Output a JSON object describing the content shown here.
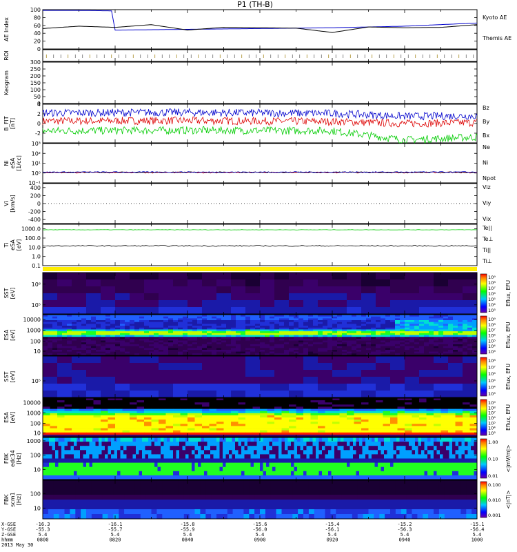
{
  "title": "P1  (TH-B)",
  "footer": {
    "labels": [
      "X-GSE",
      "Y-GSE",
      "Z-GSE",
      "hhmm",
      "2013 May 30"
    ],
    "ticks": [
      {
        "x": "-16.3",
        "y": "-55.3",
        "z": "5.4",
        "t": "0800"
      },
      {
        "x": "-16.1",
        "y": "-55.7",
        "z": "5.4",
        "t": "0820"
      },
      {
        "x": "-15.8",
        "y": "-55.9",
        "z": "5.4",
        "t": "0840"
      },
      {
        "x": "-15.6",
        "y": "-56.0",
        "z": "5.4",
        "t": "0900"
      },
      {
        "x": "-15.4",
        "y": "-56.1",
        "z": "5.4",
        "t": "0920"
      },
      {
        "x": "-15.2",
        "y": "-56.3",
        "z": "5.4",
        "t": "0940"
      },
      {
        "x": "-15.1",
        "y": "-56.4",
        "z": "5.4",
        "t": "1000"
      }
    ]
  },
  "chart_data": {
    "type": "line",
    "time_range": [
      "0800",
      "1000"
    ],
    "panels": [
      {
        "id": "ae",
        "ylabel": "AE Index",
        "yticks": [
          "100",
          "80",
          "60",
          "40",
          "20",
          "0"
        ],
        "ylim": [
          0,
          100
        ],
        "series": [
          {
            "name": "Kyoto AE",
            "color": "#0000cc",
            "x": [
              "0800",
              "0810",
              "0819",
              "0820",
              "0840",
              "0900",
              "0920",
              "0940",
              "1000"
            ],
            "y": [
              98,
              98,
              97,
              48,
              50,
              52,
              54,
              58,
              66
            ]
          },
          {
            "name": "Themis AE",
            "color": "#000000",
            "x": [
              "0800",
              "0810",
              "0820",
              "0830",
              "0840",
              "0850",
              "0900",
              "0910",
              "0920",
              "0930",
              "0940",
              "0950",
              "1000"
            ],
            "y": [
              52,
              58,
              55,
              62,
              48,
              55,
              54,
              53,
              42,
              56,
              54,
              55,
              62
            ]
          }
        ]
      },
      {
        "id": "roi",
        "ylabel": "ROI"
      },
      {
        "id": "keogram",
        "ylabel": "Keogram",
        "yticks": [
          "300",
          "250",
          "200",
          "150",
          "100",
          "50",
          "0"
        ],
        "ylim": [
          0,
          300
        ]
      },
      {
        "id": "bfit",
        "ylabel": [
          "B_FIT",
          "[nT]"
        ],
        "yticks": [
          "4",
          "2",
          "0",
          "-2"
        ],
        "ylim": [
          -4,
          4
        ],
        "series": [
          {
            "name": "Bz",
            "color": "#dd0000",
            "x": [
              "0800",
              "0840",
              "0920",
              "0940",
              "1000"
            ],
            "y": [
              0.5,
              0.6,
              0.4,
              0.0,
              0.2
            ]
          },
          {
            "name": "By",
            "color": "#00cc00",
            "x": [
              "0800",
              "0840",
              "0920",
              "0940",
              "1000"
            ],
            "y": [
              -1.5,
              -1.4,
              -1.5,
              -3.4,
              -2.8
            ]
          },
          {
            "name": "Bx",
            "color": "#0000cc",
            "x": [
              "0800",
              "0840",
              "0920",
              "0940",
              "1000"
            ],
            "y": [
              2.2,
              2.3,
              2.1,
              1.5,
              1.6
            ]
          }
        ]
      },
      {
        "id": "ni",
        "ylabel": [
          "Ni",
          "eSA",
          "[1/cc]"
        ],
        "yticks": [
          "10³",
          "10²",
          "10¹",
          "10⁰",
          "10⁻¹"
        ],
        "ylim": [
          -1,
          3
        ],
        "series_names": [
          "Ne",
          "Ni",
          "Npot"
        ],
        "series_colors": [
          "#dd0000",
          "#000000",
          "#0000cc"
        ],
        "level_log10": 0.05
      },
      {
        "id": "vi",
        "ylabel": [
          "Vi",
          "[km/s]"
        ],
        "yticks": [
          "400",
          "200",
          "0",
          "-200",
          "-400"
        ],
        "ylim": [
          -500,
          500
        ],
        "series_names": [
          "Viz",
          "Viy",
          "Vix"
        ],
        "series_colors": [
          "#dd0000",
          "#00cc00",
          "#0000cc"
        ]
      },
      {
        "id": "ti",
        "ylabel": [
          "Ti",
          "eSA",
          "[eV]"
        ],
        "yticks": [
          "1000.0",
          "100.0",
          "10.0",
          "1.0",
          "0.1"
        ],
        "ylim": [
          -1,
          3.5
        ],
        "series_names": [
          "Te||",
          "Te⊥",
          "Ti||",
          "Ti⊥"
        ],
        "series_colors": [
          "#000000",
          "#dd0000",
          "#00cc00",
          "#0000cc"
        ],
        "levels_log10": {
          "Ti||": 2.9,
          "Te||": 1.15
        }
      },
      {
        "id": "flag",
        "ylabel": ""
      },
      {
        "id": "sst_e",
        "ylabel": [
          "SST",
          "[eV]"
        ],
        "yticks": [
          "10⁶",
          "10⁵"
        ],
        "cbar_label": "Eflux, EFU",
        "cbar_ticks": [
          "10⁹",
          "10⁸",
          "10⁷",
          "10⁶",
          "10⁵",
          "10⁴",
          "10³"
        ]
      },
      {
        "id": "esa_e",
        "ylabel": [
          "ESA",
          "[eV]"
        ],
        "yticks": [
          "10000",
          "1000",
          "100",
          "10"
        ],
        "cbar_label": "Eflux, EFU",
        "cbar_ticks": [
          "10⁹",
          "10⁸",
          "10⁷",
          "10⁶",
          "10⁵",
          "10⁴",
          "10³"
        ]
      },
      {
        "id": "sst_i",
        "ylabel": [
          "SST",
          "[eV]"
        ],
        "yticks": [
          "10⁵"
        ],
        "cbar_label": "Eflux, EFU",
        "cbar_ticks": [
          "10⁸",
          "10⁷",
          "10⁶",
          "10⁵",
          "10⁴",
          "10³"
        ]
      },
      {
        "id": "esa_i",
        "ylabel": [
          "ESA",
          "[eV]"
        ],
        "yticks": [
          "10000",
          "1000",
          "100",
          "10"
        ],
        "cbar_label": "Eflux, EFU",
        "cbar_ticks": [
          "10⁹",
          "10⁸",
          "10⁷",
          "10⁶",
          "10⁵",
          "10⁴",
          "10³"
        ]
      },
      {
        "id": "fbk_e",
        "ylabel": [
          "FBK",
          "edc34",
          "[Hz]"
        ],
        "yticks": [
          "1000",
          "100",
          "10"
        ],
        "cbar_label": "<|mV/m|>",
        "cbar_ticks": [
          "1.00",
          "0.10",
          "0.01"
        ]
      },
      {
        "id": "fbk_b",
        "ylabel": [
          "FBK",
          "scm1",
          "[Hz]"
        ],
        "yticks": [
          "100",
          "10"
        ],
        "cbar_label": "<|nT|>",
        "cbar_ticks": [
          "0.100",
          "0.010",
          "0.001"
        ]
      }
    ]
  }
}
